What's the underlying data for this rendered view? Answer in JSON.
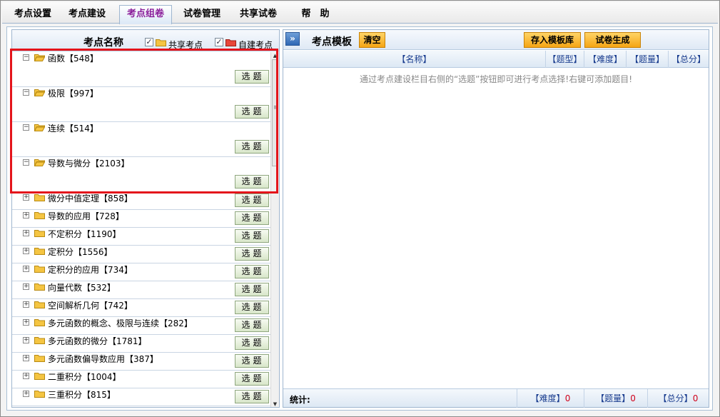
{
  "tabs": [
    {
      "label": "考点设置",
      "active": false
    },
    {
      "label": "考点建设",
      "active": false
    },
    {
      "label": "考点组卷",
      "active": true
    },
    {
      "label": "试卷管理",
      "active": false
    },
    {
      "label": "共享试卷",
      "active": false
    },
    {
      "label": "帮　助",
      "active": false
    }
  ],
  "left": {
    "title": "考点名称",
    "filters": [
      {
        "label": "共享考点",
        "checked": true,
        "folder_color": "#f5c542"
      },
      {
        "label": "自建考点",
        "checked": true,
        "folder_color": "#e8473a"
      }
    ],
    "select_label": "选题",
    "items": [
      {
        "label": "函数【548】",
        "expanded": true
      },
      {
        "label": "极限【997】",
        "expanded": true
      },
      {
        "label": "连续【514】",
        "expanded": true
      },
      {
        "label": "导数与微分【2103】",
        "expanded": true
      },
      {
        "label": "微分中值定理【858】",
        "expanded": false
      },
      {
        "label": "导数的应用【728】",
        "expanded": false
      },
      {
        "label": "不定积分【1190】",
        "expanded": false
      },
      {
        "label": "定积分【1556】",
        "expanded": false
      },
      {
        "label": "定积分的应用【734】",
        "expanded": false
      },
      {
        "label": "向量代数【532】",
        "expanded": false
      },
      {
        "label": "空间解析几何【742】",
        "expanded": false
      },
      {
        "label": "多元函数的概念、极限与连续【282】",
        "expanded": false
      },
      {
        "label": "多元函数的微分【1781】",
        "expanded": false
      },
      {
        "label": "多元函数偏导数应用【387】",
        "expanded": false
      },
      {
        "label": "二重积分【1004】",
        "expanded": false
      },
      {
        "label": "三重积分【815】",
        "expanded": false
      }
    ]
  },
  "right": {
    "title": "考点模板",
    "clear_label": "清空",
    "save_label": "存入模板库",
    "generate_label": "试卷生成",
    "columns": [
      "【名称】",
      "【题型】",
      "【难度】",
      "【题量】",
      "【总分】"
    ],
    "hint": "通过考点建设栏目右侧的“选题”按钮即可进行考点选择!右键可添加题目!",
    "footer": {
      "label": "统计:",
      "difficulty_label": "【难度】",
      "difficulty_value": "0",
      "count_label": "【题量】",
      "count_value": "0",
      "score_label": "【总分】",
      "score_value": "0"
    }
  },
  "colors": {
    "active_tab_text": "#8a1d9a",
    "highlight_border": "#e4141b",
    "orange_button": "#f5a515"
  }
}
